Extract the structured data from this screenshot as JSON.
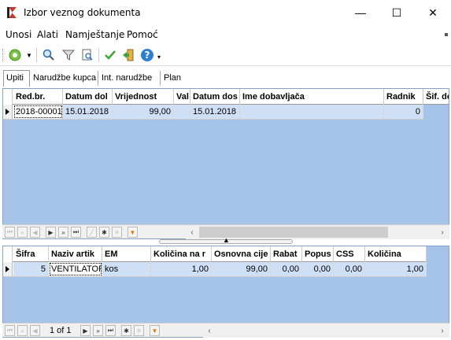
{
  "window": {
    "title": "Izbor veznog dokumenta",
    "minimize": "—",
    "maximize": "☐",
    "close": "✕"
  },
  "menu": {
    "items": [
      "Unosi",
      "Alati",
      "Namještanje",
      "Pomoć"
    ]
  },
  "toolbar": {
    "icons": [
      "new-circle-icon",
      "search-icon",
      "filter-icon",
      "preview-icon",
      "confirm-check-icon",
      "exit-door-icon",
      "help-icon"
    ]
  },
  "tabs": [
    {
      "label": "Upiti",
      "active": true
    },
    {
      "label": "Narudžbe kupca",
      "active": false
    },
    {
      "label": "Int. narudžbe",
      "active": false
    },
    {
      "label": "Plan",
      "active": false
    }
  ],
  "top_grid": {
    "columns": [
      "Red.br.",
      "Datum dol",
      "Vrijednost",
      "Val",
      "Datum dos",
      "Ime dobavljača",
      "Radnik",
      "Šif. do"
    ],
    "rows": [
      [
        "2018-00001",
        "15.01.2018",
        "99,00",
        "",
        "15.01.2018",
        "",
        "0",
        ""
      ]
    ]
  },
  "bottom_grid": {
    "columns": [
      "Šifra",
      "Naziv artik",
      "EM",
      "Količina na r",
      "Osnovna cije",
      "Rabat",
      "Popus",
      "CSS",
      "Količina"
    ],
    "rows": [
      [
        "5",
        "VENTILATOR",
        "kos",
        "1,00",
        "99,00",
        "0,00",
        "0,00",
        "0,00",
        "1,00"
      ]
    ]
  },
  "bottom_nav": {
    "page_info": "1 of 1"
  },
  "colors": {
    "grid_bg": "#a6c4ea",
    "selected_cell": "#cfe0f6"
  }
}
